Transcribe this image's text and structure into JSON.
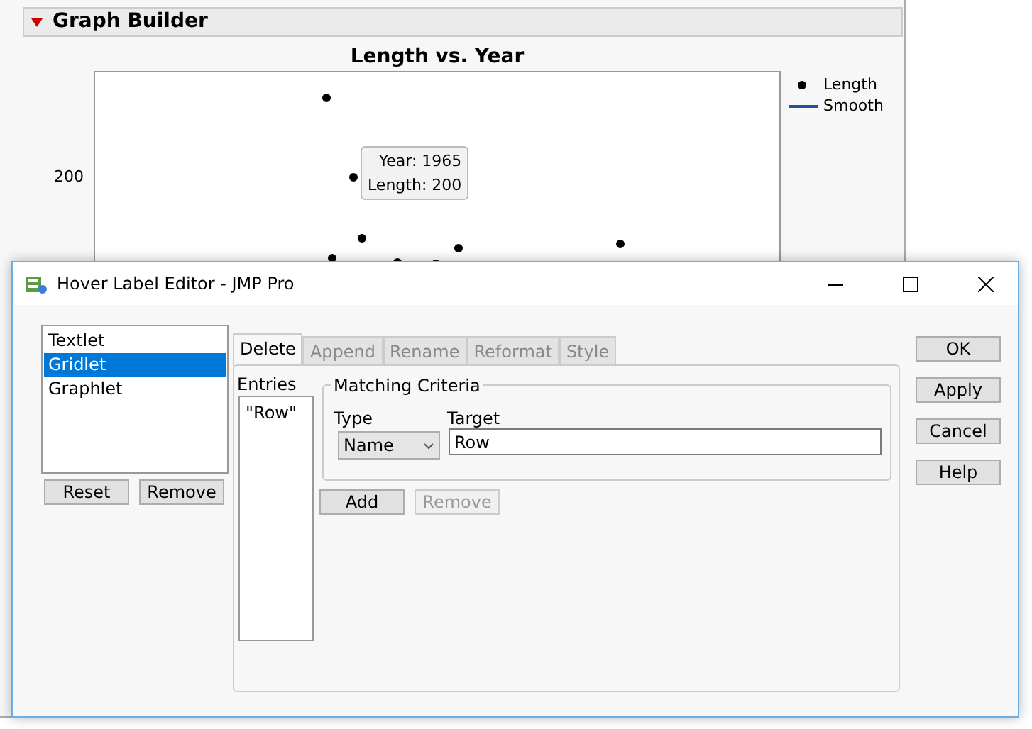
{
  "graph_builder": {
    "title": "Graph Builder",
    "chart_title": "Length vs. Year",
    "y_tick": "200",
    "legend": [
      {
        "label": "Length",
        "kind": "marker"
      },
      {
        "label": "Smooth",
        "kind": "line"
      }
    ],
    "tooltip": {
      "lines": [
        "Year: 1965",
        "Length: 200"
      ]
    }
  },
  "dialog": {
    "title": "Hover Label Editor - JMP Pro",
    "templates": [
      {
        "label": "Textlet",
        "selected": false
      },
      {
        "label": "Gridlet",
        "selected": true
      },
      {
        "label": "Graphlet",
        "selected": false
      }
    ],
    "list_buttons": [
      "Reset",
      "Remove"
    ],
    "tabs": [
      {
        "label": "Delete",
        "selected": true
      },
      {
        "label": "Append",
        "selected": false
      },
      {
        "label": "Rename",
        "selected": false
      },
      {
        "label": "Reformat",
        "selected": false
      },
      {
        "label": "Style",
        "selected": false
      }
    ],
    "entries_label": "Entries",
    "entries": [
      "\"Row\""
    ],
    "group_title": "Matching Criteria",
    "type_label": "Type",
    "type_value": "Name",
    "target_label": "Target",
    "target_value": "Row",
    "action_buttons": [
      {
        "label": "Add",
        "disabled": false
      },
      {
        "label": "Remove",
        "disabled": true
      }
    ],
    "side_buttons": [
      "OK",
      "Apply",
      "Cancel",
      "Help"
    ]
  }
}
